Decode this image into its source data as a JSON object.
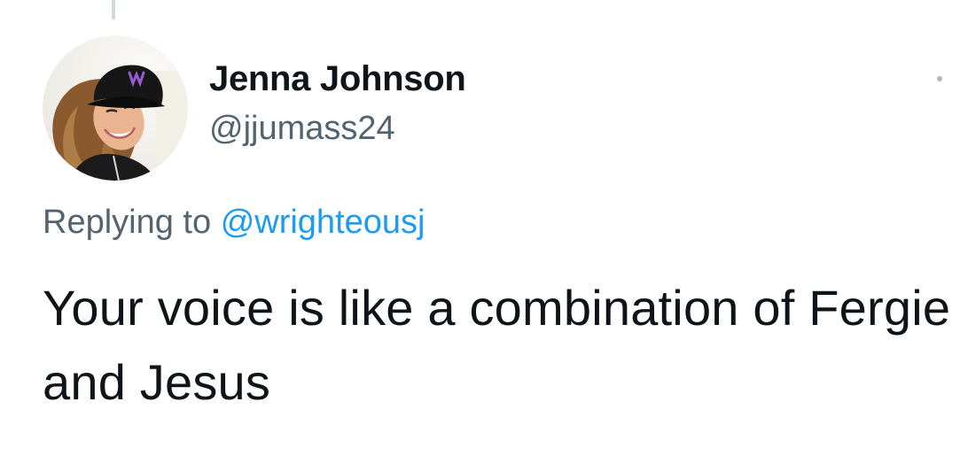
{
  "tweet": {
    "author": {
      "display_name": "Jenna Johnson",
      "handle": "@jjumass24",
      "avatar_icon": "user-avatar-photo"
    },
    "reply": {
      "prefix": "Replying to",
      "mention": "@wrighteousj"
    },
    "text": "Your voice is like a combination of Fergie and Jesus",
    "more_icon": "more-options-icon"
  },
  "colors": {
    "primary_text": "#0f1419",
    "secondary_text": "#536471",
    "link": "#1d9bf0",
    "thread_line": "#cfd9de"
  }
}
